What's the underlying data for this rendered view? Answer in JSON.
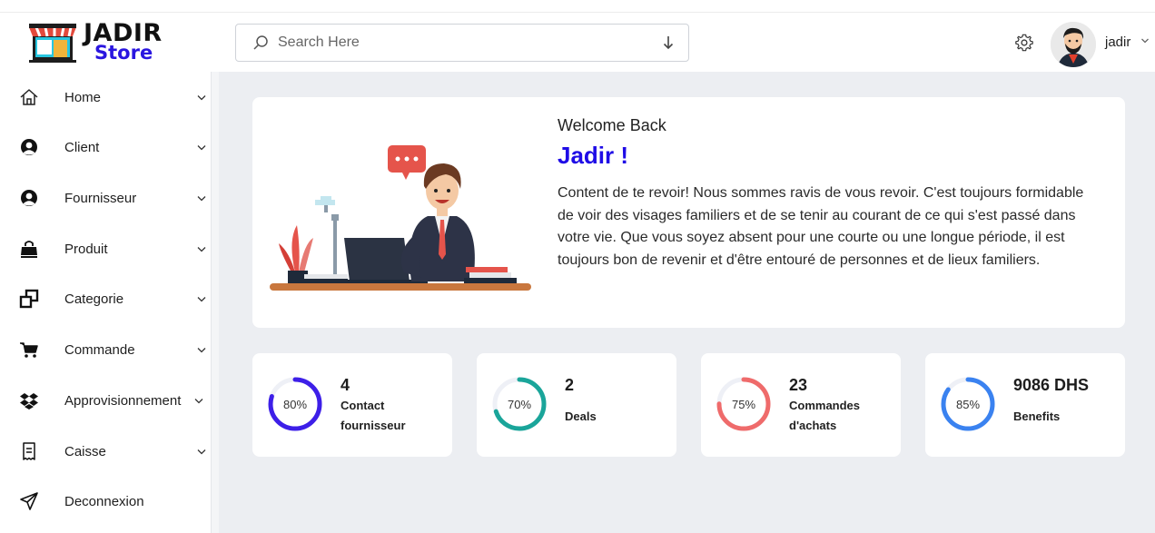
{
  "brand": {
    "title": "JADIR",
    "subtitle": "Store",
    "accent": "#2a16e0"
  },
  "search": {
    "placeholder": "Search Here"
  },
  "user": {
    "name": "jadir"
  },
  "sidebar": {
    "items": [
      {
        "label": "Home",
        "icon": "home-icon"
      },
      {
        "label": "Client",
        "icon": "user-icon"
      },
      {
        "label": "Fournisseur",
        "icon": "user-icon"
      },
      {
        "label": "Produit",
        "icon": "bag-icon"
      },
      {
        "label": "Categorie",
        "icon": "squares-icon"
      },
      {
        "label": "Commande",
        "icon": "cart-icon"
      },
      {
        "label": "Approvisionnement",
        "icon": "dropbox-icon"
      },
      {
        "label": "Caisse",
        "icon": "receipt-icon"
      },
      {
        "label": "Deconnexion",
        "icon": "send-icon"
      }
    ]
  },
  "welcome": {
    "greeting": "Welcome Back",
    "name": "Jadir !",
    "message": "Content de te revoir! Nous sommes ravis de vous revoir. C'est toujours formidable de voir des visages familiers et de se tenir au courant de ce qui s'est passé dans votre vie. Que vous soyez absent pour une courte ou une longue période, il est toujours bon de revenir et d'être entouré de personnes et de lieux familiers."
  },
  "stats": [
    {
      "percent": "80%",
      "value": "4",
      "label_lines": [
        "Contact",
        "fournisseur"
      ],
      "color": "#3d1fe8"
    },
    {
      "percent": "70%",
      "value": "2",
      "label_lines": [
        "Deals"
      ],
      "color": "#1aa59a"
    },
    {
      "percent": "75%",
      "value": "23",
      "label_lines": [
        "Commandes",
        "d'achats"
      ],
      "color": "#ef6b6b"
    },
    {
      "percent": "85%",
      "value": "9086 DHS",
      "label_lines": [
        "Benefits"
      ],
      "color": "#3a82f0"
    }
  ]
}
